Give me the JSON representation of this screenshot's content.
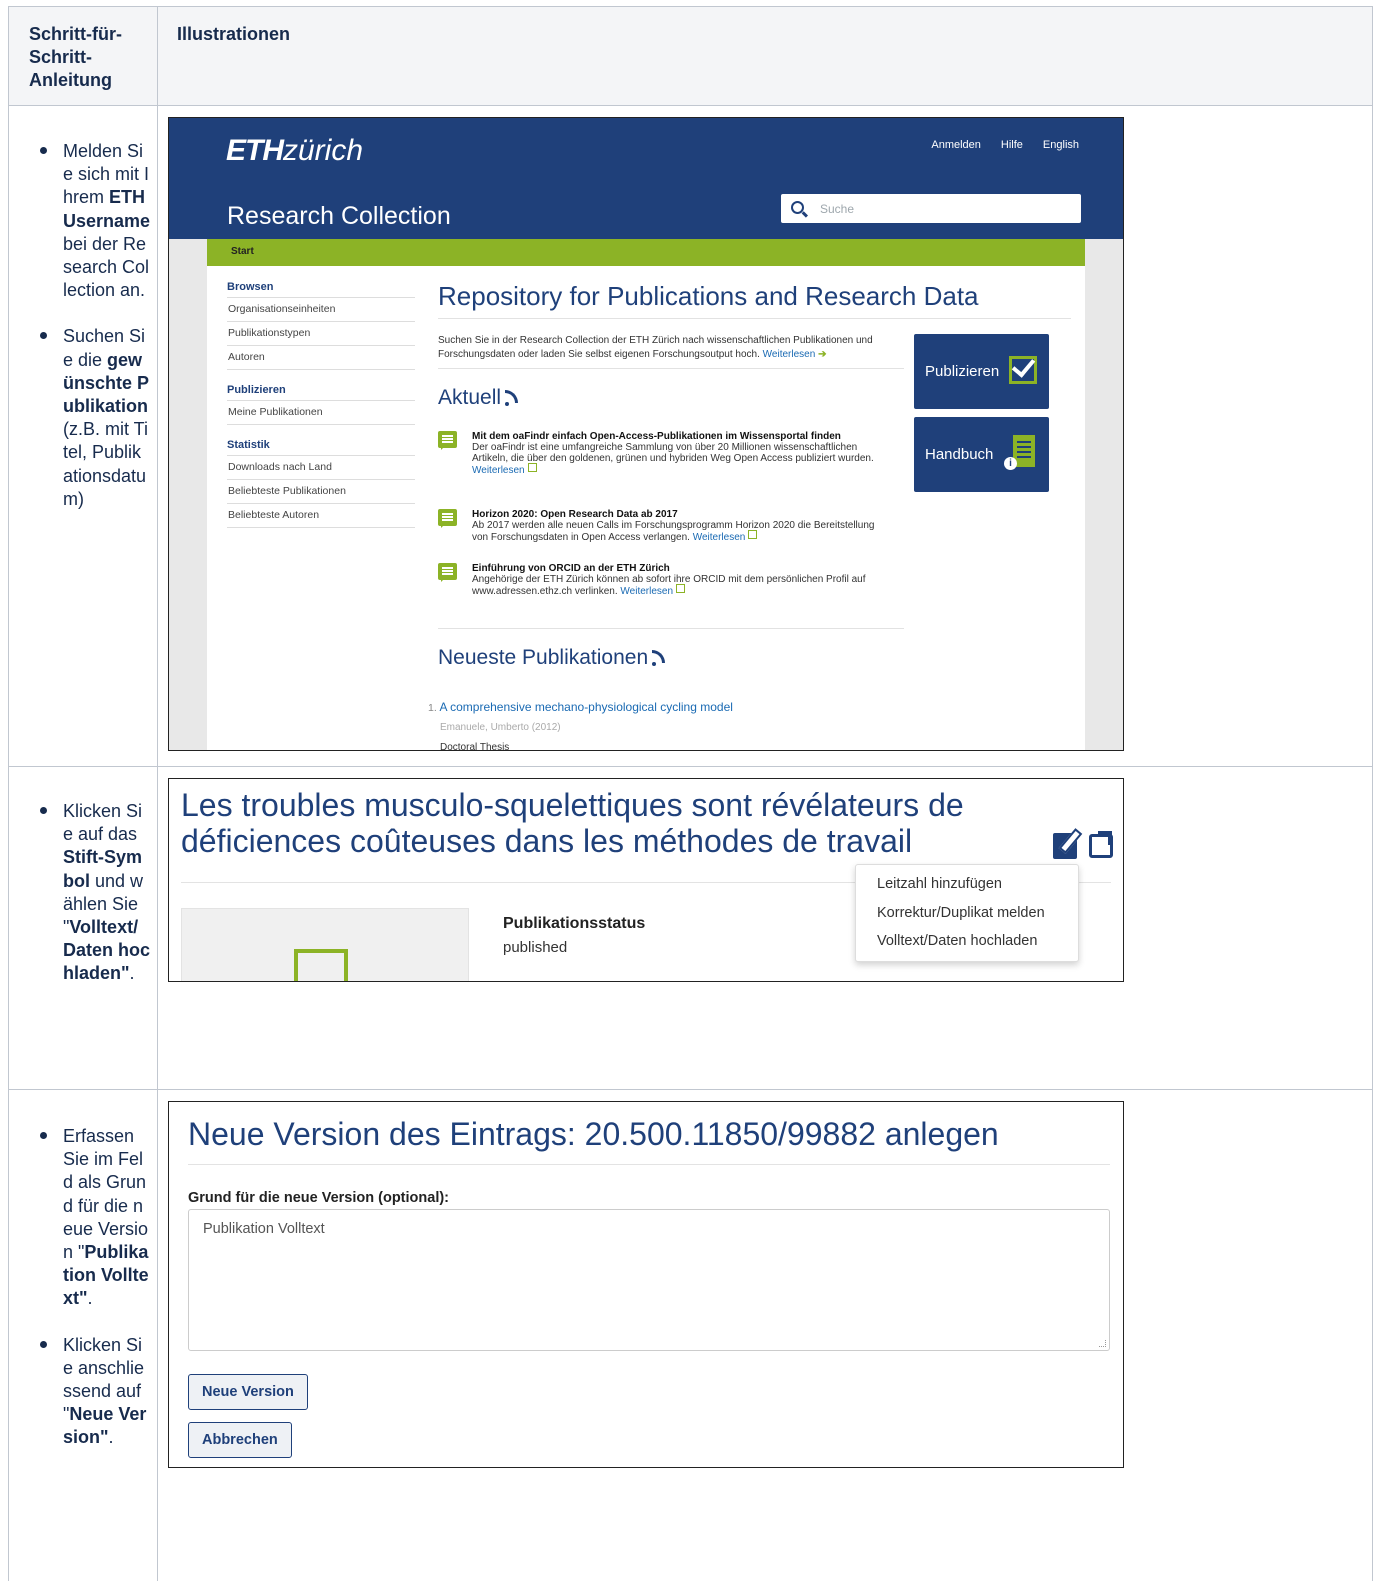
{
  "table": {
    "header_col1": "Schritt-für-Schritt-Anleitung",
    "header_col2": "Illustrationen"
  },
  "rows": [
    {
      "steps": [
        {
          "parts": [
            {
              "t": "Melden Sie sich mit Ihrem ",
              "b": false
            },
            {
              "t": "ETH Username",
              "b": true
            },
            {
              "t": " bei der Research Collection an.",
              "b": false
            }
          ]
        },
        {
          "parts": [
            {
              "t": "Suchen Sie die ",
              "b": false
            },
            {
              "t": "gewünschte Publikation",
              "b": true
            },
            {
              "t": " (z.B. mit Titel, Publikationsdatum)",
              "b": false
            }
          ]
        }
      ]
    },
    {
      "steps": [
        {
          "parts": [
            {
              "t": "Klicken Sie auf das ",
              "b": false
            },
            {
              "t": "Stift-Symbol",
              "b": true
            },
            {
              "t": " und wählen Sie \"",
              "b": false
            },
            {
              "t": "Volltext/Daten hochladen\"",
              "b": true
            },
            {
              "t": ".",
              "b": false
            }
          ]
        }
      ]
    },
    {
      "steps": [
        {
          "parts": [
            {
              "t": "Erfassen Sie im Feld als Grund für die neue Version \"",
              "b": false
            },
            {
              "t": "Publikation Volltext\"",
              "b": true
            },
            {
              "t": ".",
              "b": false
            }
          ]
        },
        {
          "parts": [
            {
              "t": "Klicken Sie anschliessend auf \"",
              "b": false
            },
            {
              "t": "Neue Version\"",
              "b": true
            },
            {
              "t": ".",
              "b": false
            }
          ]
        }
      ]
    }
  ],
  "shot1": {
    "logo_bold": "ETH",
    "logo_rest": "zürich",
    "top_links": [
      "Anmelden",
      "Hilfe",
      "English"
    ],
    "site_title": "Research Collection",
    "search_placeholder": "Suche",
    "breadcrumb": "Start",
    "sidebar": [
      {
        "heading": "Browsen",
        "items": [
          "Organisationseinheiten",
          "Publikationstypen",
          "Autoren"
        ]
      },
      {
        "heading": "Publizieren",
        "items": [
          "Meine Publikationen"
        ]
      },
      {
        "heading": "Statistik",
        "items": [
          "Downloads nach Land",
          "Beliebteste Publikationen",
          "Beliebteste Autoren"
        ]
      }
    ],
    "main_title": "Repository for Publications and Research Data",
    "intro_text": "Suchen Sie in der Research Collection der ETH Zürich nach wissenschaftlichen Publikationen und Forschungsdaten oder laden Sie selbst eigenen Forschungsoutput hoch.",
    "intro_link": "Weiterlesen",
    "aktuell_title": "Aktuell",
    "news": [
      {
        "title": "Mit dem oaFindr einfach Open-Access-Publikationen im Wissensportal finden",
        "text": "Der oaFindr ist eine umfangreiche Sammlung von über 20 Millionen wissenschaftlichen Artikeln, die über den goldenen, grünen und hybriden Weg Open Access publiziert wurden.",
        "link": "Weiterlesen"
      },
      {
        "title": "Horizon 2020: Open Research Data ab 2017",
        "text": "Ab 2017 werden alle neuen Calls im Forschungsprogramm Horizon 2020 die Bereitstellung von Forschungsdaten in Open Access verlangen.",
        "link": "Weiterlesen"
      },
      {
        "title": "Einführung von ORCID an der ETH Zürich",
        "text": "Angehörige der ETH Zürich können ab sofort ihre ORCID mit dem persönlichen Profil auf www.adressen.ethz.ch verlinken.",
        "link": "Weiterlesen"
      }
    ],
    "btn_publizieren": "Publizieren",
    "btn_handbuch": "Handbuch",
    "neueste_title": "Neueste Publikationen",
    "pub_number": "1.",
    "pub_title": "A comprehensive mechano-physiological cycling model",
    "pub_meta": "Emanuele, Umberto (2012)",
    "pub_type": "Doctoral Thesis"
  },
  "shot2": {
    "title": "Les troubles musculo-squelettiques sont révélateurs de déficiences coûteuses dans les méthodes de travail",
    "menu": [
      "Leitzahl hinzufügen",
      "Korrektur/Duplikat melden",
      "Volltext/Daten hochladen"
    ],
    "status_label": "Publikationsstatus",
    "status_value": "published"
  },
  "shot3": {
    "title": "Neue Version des Eintrags: 20.500.11850/99882 anlegen",
    "field_label": "Grund für die neue Version (optional):",
    "field_value": "Publikation Volltext",
    "btn_new": "Neue Version",
    "btn_cancel": "Abbrechen"
  }
}
